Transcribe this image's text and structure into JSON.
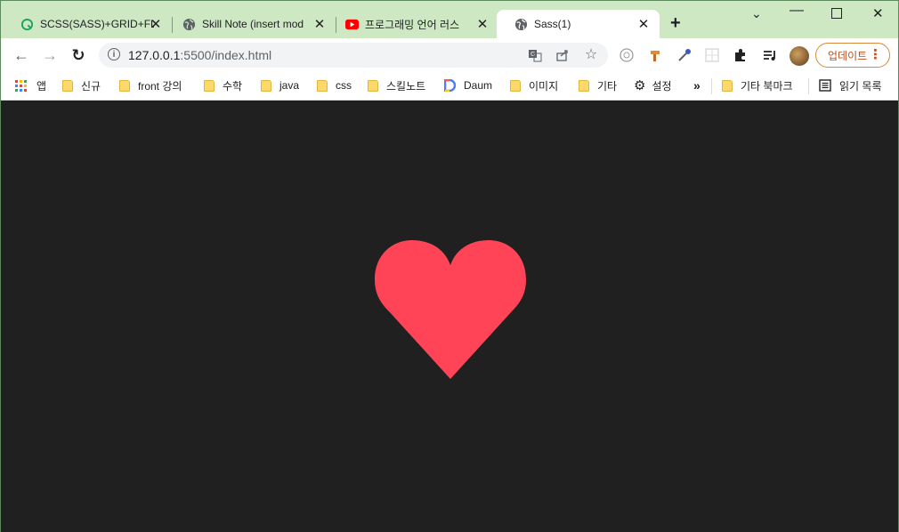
{
  "tabs": [
    {
      "title": "SCSS(SASS)+GRID+FL",
      "icon": "q-logo-icon"
    },
    {
      "title": "Skill Note (insert mod",
      "icon": "globe-icon"
    },
    {
      "title": "프로그래밍 언어 러스",
      "icon": "youtube-icon"
    },
    {
      "title": "Sass(1)",
      "icon": "globe-icon"
    }
  ],
  "toolbar": {
    "url_host": "127.0.0.1",
    "url_path": ":5500/index.html",
    "update_label": "업데이트"
  },
  "bookmarks": [
    {
      "label": "앱",
      "icon": "apps-grid-icon"
    },
    {
      "label": "신규",
      "icon": "folder-icon"
    },
    {
      "label": "front 강의",
      "icon": "folder-icon"
    },
    {
      "label": "수학",
      "icon": "folder-icon"
    },
    {
      "label": "java",
      "icon": "folder-icon"
    },
    {
      "label": "css",
      "icon": "folder-icon"
    },
    {
      "label": "스킬노트",
      "icon": "folder-icon"
    },
    {
      "label": "Daum",
      "icon": "daum-logo-icon"
    },
    {
      "label": "이미지",
      "icon": "folder-icon"
    },
    {
      "label": "기타",
      "icon": "folder-icon"
    },
    {
      "label": "설정",
      "icon": "gear-icon"
    }
  ],
  "bookmarks_overflow": "»",
  "other_bookmarks": "기타 북마크",
  "reading_list": "읽기 목록",
  "colors": {
    "heart": "#ff4458",
    "page_background": "#202020",
    "tabstrip": "#cde8c2"
  }
}
